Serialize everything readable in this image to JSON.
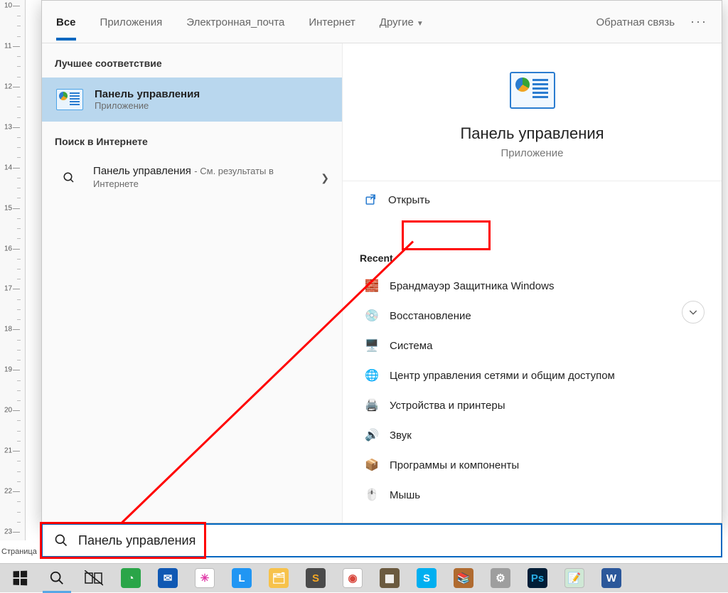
{
  "ruler": {
    "start": 10,
    "end": 23,
    "step": 1
  },
  "tabs": {
    "all": "Все",
    "apps": "Приложения",
    "email": "Электронная_почта",
    "internet": "Интернет",
    "other": "Другие",
    "feedback": "Обратная связь"
  },
  "left": {
    "best_match": "Лучшее соответствие",
    "best_match_item": {
      "title": "Панель управления",
      "subtitle": "Приложение"
    },
    "web_header": "Поиск в Интернете",
    "web_item_title": "Панель управления",
    "web_item_suffix": " - См. результаты в Интернете"
  },
  "right": {
    "title": "Панель управления",
    "subtitle": "Приложение",
    "open": "Открыть",
    "recent_header": "Recent",
    "recent": [
      {
        "label": "Брандмауэр Защитника Windows",
        "icon": "🧱",
        "color": "#b55a29"
      },
      {
        "label": "Восстановление",
        "icon": "💿",
        "color": "#2a7cd0"
      },
      {
        "label": "Система",
        "icon": "🖥️",
        "color": "#2a7cd0"
      },
      {
        "label": "Центр управления сетями и общим доступом",
        "icon": "🌐",
        "color": "#2a7cd0"
      },
      {
        "label": "Устройства и принтеры",
        "icon": "🖨️",
        "color": "#555"
      },
      {
        "label": "Звук",
        "icon": "🔊",
        "color": "#555"
      },
      {
        "label": "Программы и компоненты",
        "icon": "📦",
        "color": "#b79423"
      },
      {
        "label": "Мышь",
        "icon": "🖱️",
        "color": "#555"
      }
    ]
  },
  "search": {
    "value": "Панель управления"
  },
  "status": "Страница",
  "taskbar": [
    {
      "name": "start",
      "bg": "",
      "txt": "",
      "sel": false
    },
    {
      "name": "search",
      "bg": "",
      "txt": "",
      "sel": true
    },
    {
      "name": "taskview",
      "bg": "",
      "txt": "",
      "sel": false
    },
    {
      "name": "browser",
      "bg": "#2aa548",
      "txt": "◔",
      "sel": false
    },
    {
      "name": "mail",
      "bg": "#0f58b3",
      "txt": "✉",
      "sel": false
    },
    {
      "name": "snip",
      "bg": "#ffffff",
      "txt": "✳",
      "sel": false,
      "fg": "#e03aa8"
    },
    {
      "name": "l-app",
      "bg": "#2196f3",
      "txt": "L",
      "sel": false
    },
    {
      "name": "explorer",
      "bg": "#f7c24b",
      "txt": "🗂",
      "sel": false
    },
    {
      "name": "sublime",
      "bg": "#4a4a4a",
      "txt": "S",
      "sel": false,
      "fg": "#f6a623"
    },
    {
      "name": "chrome",
      "bg": "#ffffff",
      "txt": "◉",
      "sel": false,
      "fg": "#d8463c"
    },
    {
      "name": "textures",
      "bg": "#6b5a3f",
      "txt": "▦",
      "sel": false
    },
    {
      "name": "skype",
      "bg": "#00aff0",
      "txt": "S",
      "sel": false
    },
    {
      "name": "winrar",
      "bg": "#b06b30",
      "txt": "📚",
      "sel": false
    },
    {
      "name": "settings",
      "bg": "#9e9e9e",
      "txt": "⚙",
      "sel": false
    },
    {
      "name": "photoshop",
      "bg": "#001d36",
      "txt": "Ps",
      "sel": false,
      "fg": "#29abe2"
    },
    {
      "name": "notepad",
      "bg": "#cfe8d5",
      "txt": "📝",
      "sel": false
    },
    {
      "name": "word",
      "bg": "#2b579a",
      "txt": "W",
      "sel": false
    }
  ]
}
